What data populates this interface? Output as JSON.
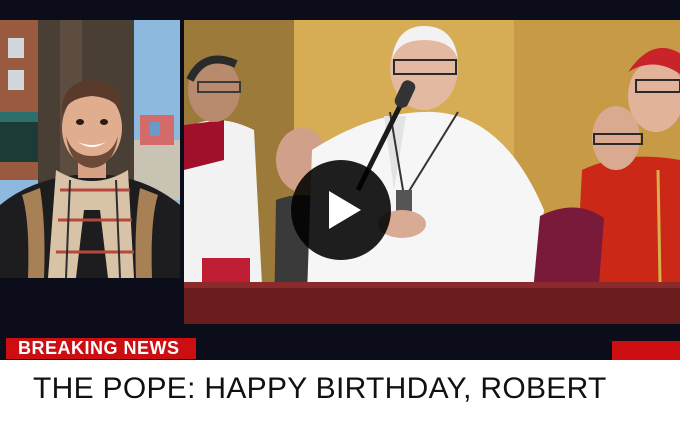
{
  "banner": {
    "label": "BREAKING NEWS",
    "headline": "THE POPE: HAPPY BIRTHDAY, ROBERT"
  },
  "player": {
    "play_icon": "play-icon"
  },
  "colors": {
    "breaking_red": "#cc0e12",
    "background": "#0c0d1a",
    "ticker_bg": "#ffffff"
  }
}
